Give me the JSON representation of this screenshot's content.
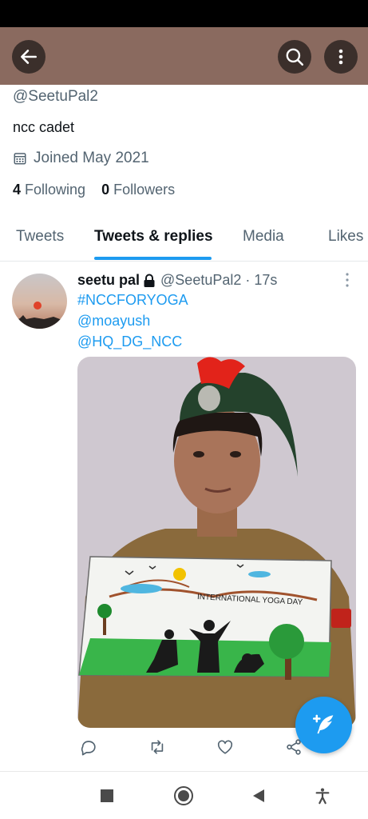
{
  "profile": {
    "handle": "@SeetuPal2",
    "bio": "ncc cadet",
    "joined": "Joined May 2021",
    "following_count": "4",
    "following_label": "Following",
    "followers_count": "0",
    "followers_label": "Followers"
  },
  "tabs": [
    {
      "label": "Tweets",
      "active": false
    },
    {
      "label": "Tweets & replies",
      "active": true
    },
    {
      "label": "Media",
      "active": false
    },
    {
      "label": "Likes",
      "active": false
    }
  ],
  "tweet": {
    "author_name": "seetu pal",
    "author_handle": "@SeetuPal2",
    "time": "· 17s",
    "lines": [
      "#NCCFORYOGA",
      "@moayush",
      "@HQ_DG_NCC"
    ],
    "media_caption": "INTERNATIONAL YOGA DAY"
  },
  "icons": {
    "back": "arrow-left-icon",
    "search": "search-icon",
    "more": "more-vertical-icon",
    "calendar": "calendar-icon",
    "lock": "lock-icon",
    "reply": "reply-icon",
    "retweet": "retweet-icon",
    "like": "heart-icon",
    "share": "share-icon",
    "compose": "compose-tweet-icon"
  },
  "colors": {
    "header": "#8a6a5f",
    "accent": "#1d9bf0",
    "text": "#0f1419",
    "secondary": "#536471"
  }
}
